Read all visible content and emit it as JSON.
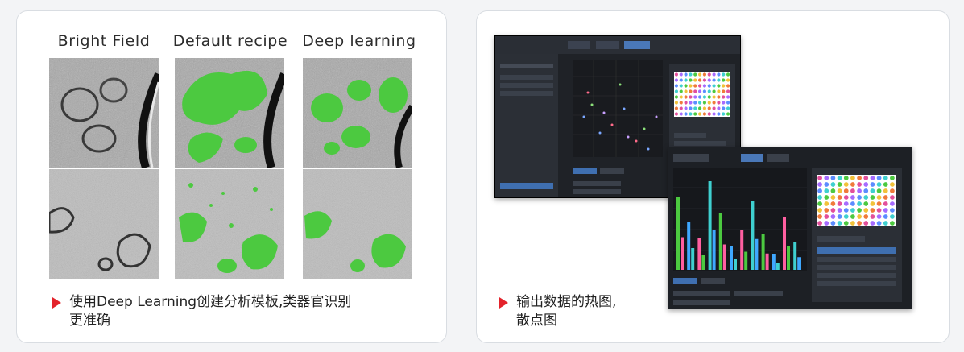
{
  "left_panel": {
    "columns": [
      "Bright Field",
      "Default recipe",
      "Deep learning"
    ],
    "caption_line1": "使用Deep Learning创建分析模板,类器官识别",
    "caption_line2": "更准确"
  },
  "right_panel": {
    "caption_line1": "输出数据的热图,",
    "caption_line2": "散点图"
  },
  "colors": {
    "accent_red": "#e3232b",
    "segmentation_green": "#4cc940",
    "app_dark": "#1c1f24"
  }
}
